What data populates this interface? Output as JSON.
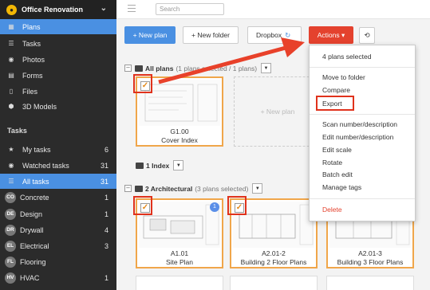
{
  "sidebar": {
    "project": "Office Renovation",
    "items": [
      {
        "label": "Plans",
        "icon": "plans-icon",
        "glyph": "▦"
      },
      {
        "label": "Tasks",
        "icon": "tasks-icon",
        "glyph": "☰"
      },
      {
        "label": "Photos",
        "icon": "camera-icon",
        "glyph": "◉"
      },
      {
        "label": "Forms",
        "icon": "forms-icon",
        "glyph": "▤"
      },
      {
        "label": "Files",
        "icon": "file-icon",
        "glyph": "▯"
      },
      {
        "label": "3D Models",
        "icon": "cube-icon",
        "glyph": "⬢"
      }
    ],
    "tasks_header": "Tasks",
    "task_filters": [
      {
        "label": "My tasks",
        "count": "6",
        "glyph": "★"
      },
      {
        "label": "Watched tasks",
        "count": "31",
        "glyph": "◉"
      },
      {
        "label": "All tasks",
        "count": "31",
        "glyph": "☰"
      }
    ],
    "categories": [
      {
        "badge": "CO",
        "label": "Concrete",
        "count": "1"
      },
      {
        "badge": "DE",
        "label": "Design",
        "count": "1"
      },
      {
        "badge": "DR",
        "label": "Drywall",
        "count": "4"
      },
      {
        "badge": "EL",
        "label": "Electrical",
        "count": "3"
      },
      {
        "badge": "FL",
        "label": "Flooring",
        "count": ""
      },
      {
        "badge": "HV",
        "label": "HVAC",
        "count": "1"
      }
    ]
  },
  "topbar": {
    "search_placeholder": "Search"
  },
  "toolbar": {
    "new_plan": "+ New plan",
    "new_folder": "+ New folder",
    "dropbox": "Dropbox",
    "actions": "Actions ▾"
  },
  "groups": {
    "all_plans": {
      "name": "All plans",
      "detail": "(1 plans selected / 1 plans)"
    },
    "index": {
      "name": "1 Index"
    },
    "arch": {
      "name": "2 Architectural",
      "detail": "(3 plans selected)"
    }
  },
  "new_plan_placeholder": "+ New plan",
  "plans": [
    {
      "number": "G1.00",
      "title": "Cover Index"
    },
    {
      "number": "A1.01",
      "title": "Site Plan",
      "badge": "1"
    },
    {
      "number": "A2.01-2",
      "title": "Building 2 Floor Plans"
    },
    {
      "number": "A2.01-3",
      "title": "Building 3 Floor Plans"
    }
  ],
  "actions_menu": {
    "header": "4 plans selected",
    "items": [
      "Move to folder",
      "Compare",
      "Export",
      "Scan number/description",
      "Edit number/description",
      "Edit scale",
      "Rotate",
      "Batch edit",
      "Manage tags"
    ],
    "danger": "Delete"
  },
  "colors": {
    "accent": "#4a90e2",
    "actions": "#e4422e",
    "highlight": "#e0321c",
    "selected": "#f0a64a"
  }
}
